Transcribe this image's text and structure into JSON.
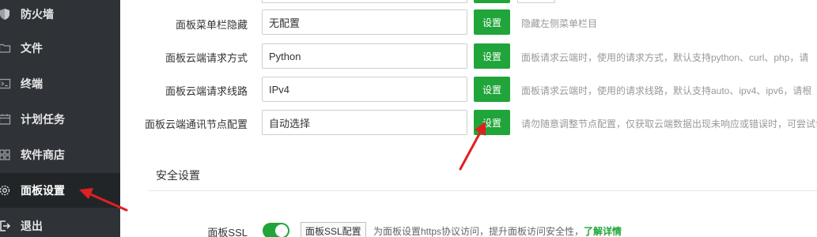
{
  "sidebar": {
    "items": [
      {
        "label": "防火墙",
        "icon": "shield-icon"
      },
      {
        "label": "文件",
        "icon": "folder-icon"
      },
      {
        "label": "终端",
        "icon": "terminal-icon"
      },
      {
        "label": "计划任务",
        "icon": "calendar-icon"
      },
      {
        "label": "软件商店",
        "icon": "grid-icon"
      },
      {
        "label": "面板设置",
        "icon": "gear-icon",
        "active": true
      },
      {
        "label": "退出",
        "icon": "logout-icon"
      }
    ]
  },
  "settings": {
    "rows": [
      {
        "label": "面板菜单栏隐藏",
        "value": "无配置",
        "button": "设置",
        "hint": "隐藏左侧菜单栏目"
      },
      {
        "label": "面板云端请求方式",
        "value": "Python",
        "button": "设置",
        "hint": "面板请求云端时，使用的请求方式，默认支持python、curl、php，请"
      },
      {
        "label": "面板云端请求线路",
        "value": "IPv4",
        "button": "设置",
        "hint": "面板请求云端时，使用的请求线路，默认支持auto、ipv4、ipv6，请根"
      },
      {
        "label": "面板云端通讯节点配置",
        "value": "自动选择",
        "button": "设置",
        "hint": "请勿随意调整节点配置，仅获取云端数据出现未响应或错误时，可尝试切"
      }
    ]
  },
  "security": {
    "title": "安全设置",
    "ssl_label": "面板SSL",
    "ssl_enabled": true,
    "ssl_config_button": "面板SSL配置",
    "ssl_hint": "为面板设置https协议访问，提升面板访问安全性，",
    "ssl_link": "了解详情"
  },
  "colors": {
    "accent": "#20a53a",
    "sidebar_bg": "#2f3338",
    "annotation": "#e02020"
  }
}
